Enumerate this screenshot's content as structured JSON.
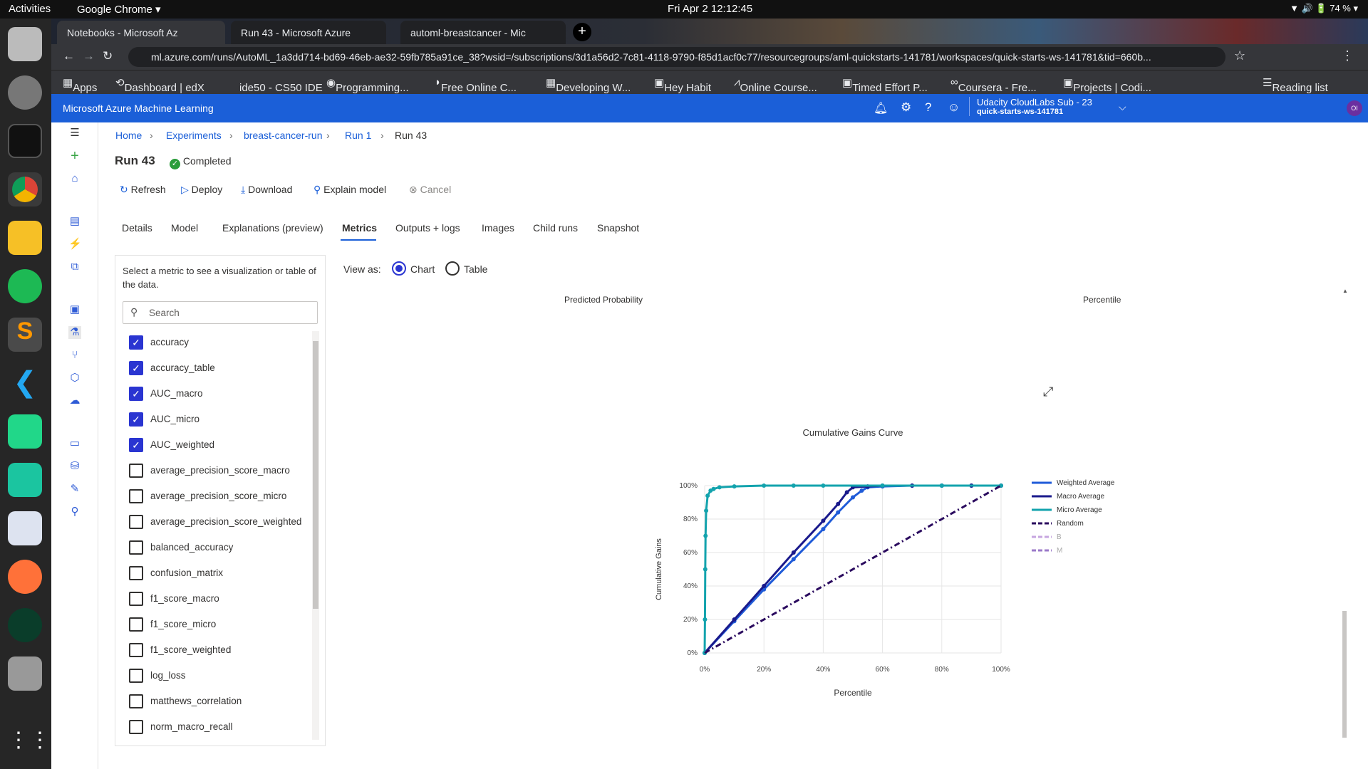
{
  "os": {
    "activities": "Activities",
    "app": "Google Chrome ▾",
    "clock": "Fri Apr 2  12:12:45",
    "battery": "74 %"
  },
  "browser": {
    "tabs": [
      "Notebooks - Microsoft Az",
      "Run 43 - Microsoft Azure",
      "automl-breastcancer - Mic"
    ],
    "url": "ml.azure.com/runs/AutoML_1a3dd714-bd69-46eb-ae32-59fb785a91ce_38?wsid=/subscriptions/3d1a56d2-7c81-4118-9790-f85d1acf0c77/resourcegroups/aml-quickstarts-141781/workspaces/quick-starts-ws-141781&tid=660b...",
    "bookmarks": [
      "Apps",
      "Dashboard | edX",
      "ide50 - CS50 IDE",
      "Programming...",
      "Free Online C...",
      "Developing W...",
      "Hey Habit",
      "Online Course...",
      "Timed Effort P...",
      "Coursera - Fre...",
      "Projects | Codi..."
    ],
    "reading_list": "Reading list"
  },
  "azure": {
    "product": "Microsoft Azure Machine Learning",
    "subscription": "Udacity CloudLabs Sub - 23",
    "workspace": "quick-starts-ws-141781",
    "avatar": "OI"
  },
  "breadcrumb": [
    "Home",
    "Experiments",
    "breast-cancer-run",
    "Run 1",
    "Run 43"
  ],
  "run": {
    "title": "Run 43",
    "status": "Completed"
  },
  "toolbar": [
    "Refresh",
    "Deploy",
    "Download",
    "Explain model",
    "Cancel"
  ],
  "tabs": [
    "Details",
    "Model",
    "Explanations (preview)",
    "Metrics",
    "Outputs + logs",
    "Images",
    "Child runs",
    "Snapshot"
  ],
  "active_tab": "Metrics",
  "metrics_panel": {
    "intro": "Select a metric to see a visualization or table of the data.",
    "search_placeholder": "Search",
    "items": [
      {
        "name": "accuracy",
        "checked": true
      },
      {
        "name": "accuracy_table",
        "checked": true
      },
      {
        "name": "AUC_macro",
        "checked": true
      },
      {
        "name": "AUC_micro",
        "checked": true
      },
      {
        "name": "AUC_weighted",
        "checked": true
      },
      {
        "name": "average_precision_score_macro",
        "checked": false
      },
      {
        "name": "average_precision_score_micro",
        "checked": false
      },
      {
        "name": "average_precision_score_weighted",
        "checked": false
      },
      {
        "name": "balanced_accuracy",
        "checked": false
      },
      {
        "name": "confusion_matrix",
        "checked": false
      },
      {
        "name": "f1_score_macro",
        "checked": false
      },
      {
        "name": "f1_score_micro",
        "checked": false
      },
      {
        "name": "f1_score_weighted",
        "checked": false
      },
      {
        "name": "log_loss",
        "checked": false
      },
      {
        "name": "matthews_correlation",
        "checked": false
      },
      {
        "name": "norm_macro_recall",
        "checked": false
      }
    ]
  },
  "view_as": {
    "label": "View as:",
    "options": [
      "Chart",
      "Table"
    ],
    "selected": "Chart"
  },
  "upper_labels": {
    "left": "Predicted Probability",
    "right": "Percentile"
  },
  "chart_data": {
    "type": "line",
    "title": "Cumulative Gains Curve",
    "xlabel": "Percentile",
    "ylabel": "Cumulative Gains",
    "xlim": [
      0,
      100
    ],
    "ylim": [
      0,
      100
    ],
    "xticks": [
      "0%",
      "20%",
      "40%",
      "60%",
      "80%",
      "100%"
    ],
    "yticks": [
      "0%",
      "20%",
      "40%",
      "60%",
      "80%",
      "100%"
    ],
    "grid": true,
    "legend_position": "right",
    "series": [
      {
        "name": "Weighted Average",
        "color": "#1f5bd8",
        "x": [
          0,
          10,
          20,
          30,
          40,
          45,
          50,
          53,
          55,
          60,
          70,
          80,
          90,
          100
        ],
        "y": [
          0,
          19,
          38,
          56,
          74,
          84,
          93,
          97,
          99,
          99.5,
          100,
          100,
          100,
          100
        ]
      },
      {
        "name": "Macro Average",
        "color": "#1a1a8c",
        "x": [
          0,
          10,
          20,
          30,
          40,
          45,
          48,
          50,
          55,
          60,
          70,
          80,
          90,
          100
        ],
        "y": [
          0,
          20,
          40,
          60,
          79,
          89,
          96,
          99,
          99.5,
          100,
          100,
          100,
          100,
          100
        ]
      },
      {
        "name": "Micro Average",
        "color": "#13a3ad",
        "x": [
          0,
          0.1,
          0.2,
          0.3,
          0.5,
          1,
          2,
          3,
          5,
          10,
          20,
          30,
          40,
          60,
          80,
          100
        ],
        "y": [
          0,
          20,
          50,
          70,
          85,
          94,
          97,
          98,
          99,
          99.5,
          100,
          100,
          100,
          100,
          100,
          100
        ]
      },
      {
        "name": "Random",
        "color": "#2a0a5e",
        "dash": true,
        "x": [
          0,
          100
        ],
        "y": [
          0,
          100
        ]
      },
      {
        "name": "B",
        "color": "#c7a6e0",
        "dash": true,
        "x": [],
        "y": []
      },
      {
        "name": "M",
        "color": "#9b7ac9",
        "dash": true,
        "x": [],
        "y": []
      }
    ]
  }
}
